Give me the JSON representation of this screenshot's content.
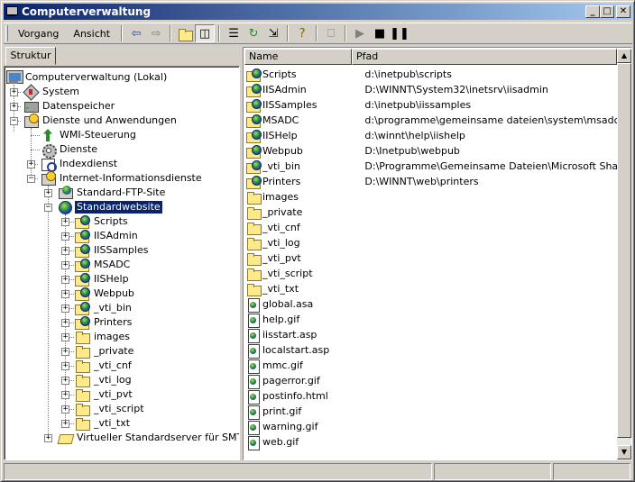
{
  "window": {
    "title": "Computerverwaltung"
  },
  "title_buttons": {
    "minimize": "_",
    "maximize": "□",
    "close": "✕"
  },
  "menu": {
    "vorgang": "Vorgang",
    "ansicht": "Ansicht"
  },
  "toolbar_icons": [
    "back-icon",
    "forward-icon",
    "up-folder-icon",
    "show-hide-tree-icon",
    "properties-icon",
    "refresh-icon",
    "export-list-icon",
    "help-icon",
    "connect-computer-icon",
    "play-icon",
    "stop-icon",
    "pause-icon"
  ],
  "tab": {
    "label": "Struktur"
  },
  "tree": {
    "root": "Computerverwaltung (Lokal)",
    "system": "System",
    "datenspeicher": "Datenspeicher",
    "dienste_anw": "Dienste und Anwendungen",
    "wmi": "WMI-Steuerung",
    "dienste": "Dienste",
    "indexdienst": "Indexdienst",
    "iis": "Internet-Informationsdienste",
    "ftp": "Standard-FTP-Site",
    "website": "Standardwebsite",
    "children": [
      "Scripts",
      "IISAdmin",
      "IISSamples",
      "MSADC",
      "IISHelp",
      "Webpub",
      "_vti_bin",
      "Printers",
      "images",
      "_private",
      "_vti_cnf",
      "_vti_log",
      "_vti_pvt",
      "_vti_script",
      "_vti_txt"
    ],
    "smtp": "Virtueller Standardserver für SMTP"
  },
  "list": {
    "columns": {
      "name": "Name",
      "path": "Pfad"
    },
    "rows": [
      {
        "name": "Scripts",
        "path": "d:\\inetpub\\scripts",
        "icon": "vdir"
      },
      {
        "name": "IISAdmin",
        "path": "D:\\WINNT\\System32\\inetsrv\\iisadmin",
        "icon": "vdir"
      },
      {
        "name": "IISSamples",
        "path": "d:\\inetpub\\iissamples",
        "icon": "vdir"
      },
      {
        "name": "MSADC",
        "path": "d:\\programme\\gemeinsame dateien\\system\\msadc",
        "icon": "vdir"
      },
      {
        "name": "IISHelp",
        "path": "d:\\winnt\\help\\iishelp",
        "icon": "vdir"
      },
      {
        "name": "Webpub",
        "path": "D:\\Inetpub\\webpub",
        "icon": "vdir"
      },
      {
        "name": "_vti_bin",
        "path": "D:\\Programme\\Gemeinsame Dateien\\Microsoft Shared\\W...",
        "icon": "vdir"
      },
      {
        "name": "Printers",
        "path": "D:\\WINNT\\web\\printers",
        "icon": "vdir"
      },
      {
        "name": "images",
        "path": "",
        "icon": "folder"
      },
      {
        "name": "_private",
        "path": "",
        "icon": "folder"
      },
      {
        "name": "_vti_cnf",
        "path": "",
        "icon": "folder"
      },
      {
        "name": "_vti_log",
        "path": "",
        "icon": "folder"
      },
      {
        "name": "_vti_pvt",
        "path": "",
        "icon": "folder"
      },
      {
        "name": "_vti_script",
        "path": "",
        "icon": "folder"
      },
      {
        "name": "_vti_txt",
        "path": "",
        "icon": "folder"
      },
      {
        "name": "global.asa",
        "path": "",
        "icon": "file"
      },
      {
        "name": "help.gif",
        "path": "",
        "icon": "file"
      },
      {
        "name": "iisstart.asp",
        "path": "",
        "icon": "file"
      },
      {
        "name": "localstart.asp",
        "path": "",
        "icon": "file"
      },
      {
        "name": "mmc.gif",
        "path": "",
        "icon": "file"
      },
      {
        "name": "pagerror.gif",
        "path": "",
        "icon": "file"
      },
      {
        "name": "postinfo.html",
        "path": "",
        "icon": "file"
      },
      {
        "name": "print.gif",
        "path": "",
        "icon": "file"
      },
      {
        "name": "warning.gif",
        "path": "",
        "icon": "file"
      },
      {
        "name": "web.gif",
        "path": "",
        "icon": "file"
      }
    ]
  },
  "scroll": {
    "up": "▲",
    "down": "▼"
  },
  "colors": {
    "titlebar": "#0a246a",
    "selection": "#0a246a",
    "face": "#d4d0c8"
  }
}
